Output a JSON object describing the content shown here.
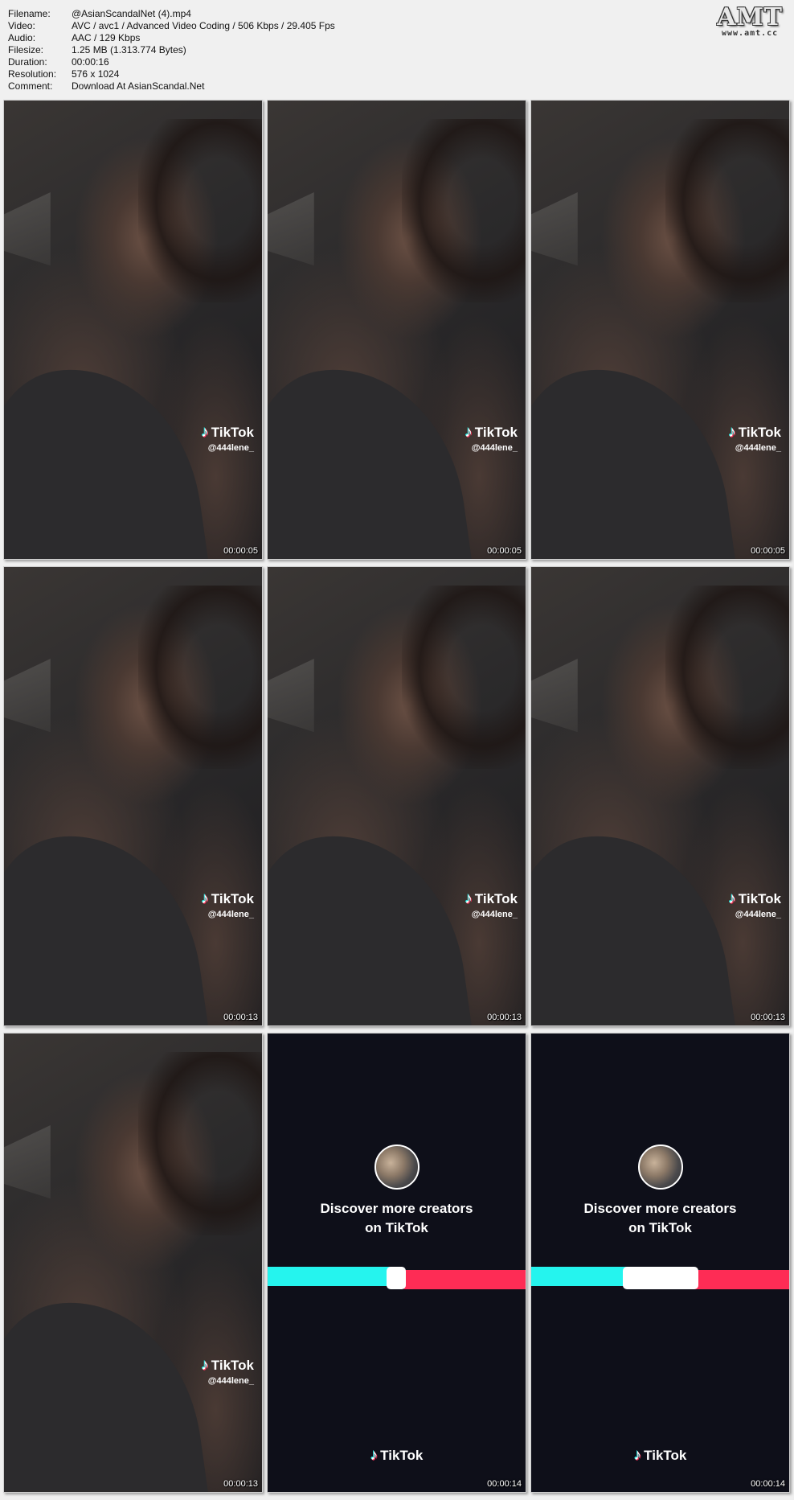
{
  "info": {
    "rows": [
      {
        "key": "Filename:",
        "value": "@AsianScandalNet (4).mp4"
      },
      {
        "key": "Video:",
        "value": "AVC / avc1 / Advanced Video Coding / 506 Kbps / 29.405 Fps"
      },
      {
        "key": "Audio:",
        "value": "AAC / 129 Kbps"
      },
      {
        "key": "Filesize:",
        "value": "1.25 MB (1.313.774 Bytes)"
      },
      {
        "key": "Duration:",
        "value": "00:00:16"
      },
      {
        "key": "Resolution:",
        "value": "576 x 1024"
      },
      {
        "key": "Comment:",
        "value": "Download At AsianScandal.Net"
      }
    ]
  },
  "logo": {
    "text": "AMT",
    "sub": "www.amt.cc"
  },
  "tiktok": {
    "brand": "TikTok",
    "username": "@444lene_",
    "end_text_line1": "Discover more creators",
    "end_text_line2": "on TikTok",
    "colors": {
      "cyan": "#25f4ee",
      "red": "#fe2c55",
      "end_bg": "#0e0f19"
    }
  },
  "thumbnails": [
    {
      "type": "video",
      "time": "00:00:05"
    },
    {
      "type": "video",
      "time": "00:00:05"
    },
    {
      "type": "video",
      "time": "00:00:05"
    },
    {
      "type": "video",
      "time": "00:00:13"
    },
    {
      "type": "video",
      "time": "00:00:13"
    },
    {
      "type": "video",
      "time": "00:00:13"
    },
    {
      "type": "video",
      "time": "00:00:13"
    },
    {
      "type": "end",
      "time": "00:00:14"
    },
    {
      "type": "end",
      "time": "00:00:14"
    }
  ]
}
